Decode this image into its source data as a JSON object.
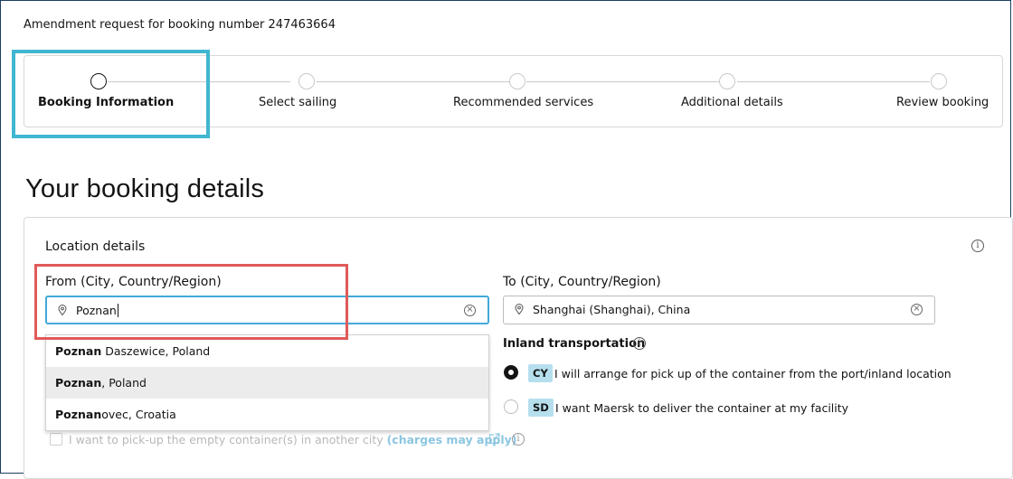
{
  "header": {
    "title": "Amendment request for booking number 247463664"
  },
  "stepper": {
    "steps": [
      {
        "label": "Booking Information",
        "active": true
      },
      {
        "label": "Select sailing",
        "active": false
      },
      {
        "label": "Recommended services",
        "active": false
      },
      {
        "label": "Additional details",
        "active": false
      },
      {
        "label": "Review booking",
        "active": false
      }
    ]
  },
  "page": {
    "title": "Your booking details"
  },
  "location": {
    "section_title": "Location details",
    "from": {
      "label": "From (City, Country/Region)",
      "value": "Poznan"
    },
    "to": {
      "label": "To (City, Country/Region)",
      "value": "Shanghai (Shanghai), China"
    },
    "suggestions": [
      {
        "match": "Poznan",
        "rest": " Daszewice, Poland"
      },
      {
        "match": "Poznan",
        "rest": ", Poland"
      },
      {
        "match": "Poznan",
        "rest": "ovec, Croatia"
      }
    ]
  },
  "inland": {
    "label": "Inland transportation",
    "options": [
      {
        "code": "CY",
        "text": "I will arrange for pick up of the container from the port/inland location",
        "selected": true
      },
      {
        "code": "SD",
        "text": "I want Maersk to deliver the container at my facility",
        "selected": false
      }
    ]
  },
  "empty_pickup": {
    "text": "I want to pick-up the empty container(s) in another city ",
    "link": "(charges may apply)"
  },
  "icons": {
    "info": "info-icon",
    "pin": "location-pin-icon",
    "clear": "clear-icon",
    "external": "external-link-icon"
  },
  "colors": {
    "focus_border": "#42a9d9",
    "badge_bg": "#b6dfee",
    "annotation_blue": "#40b6d1",
    "annotation_red": "#e05a5a",
    "link": "#8cc6e0"
  }
}
